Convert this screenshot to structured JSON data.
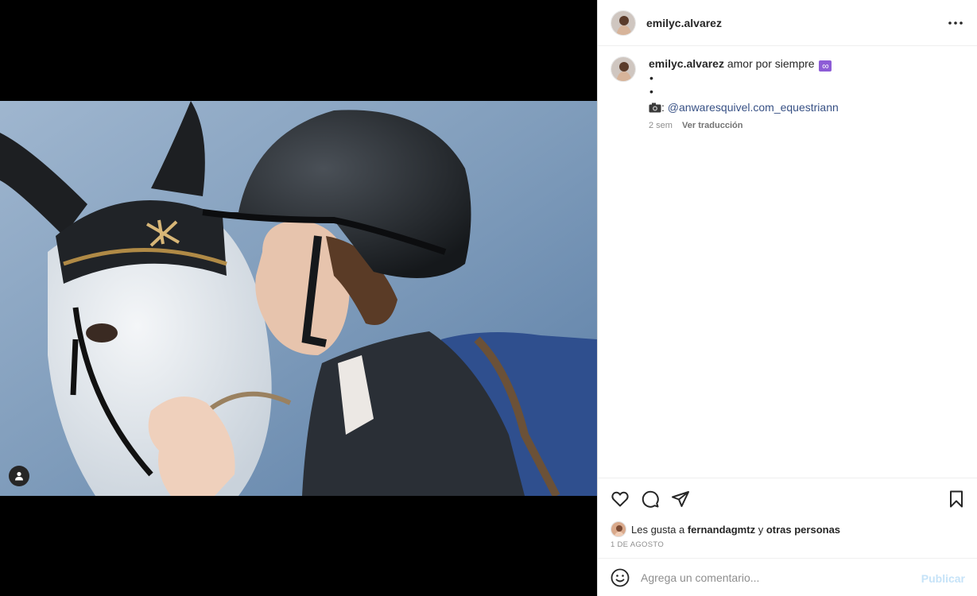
{
  "post": {
    "username": "emilyc.alvarez",
    "caption": {
      "username": "emilyc.alvarez",
      "text": "amor por siempre",
      "emoji": "∞",
      "bullets": [
        "•",
        "•"
      ],
      "credit_prefix": ":",
      "mention": "@anwaresquivel.com_equestriann",
      "time_ago": "2 sem",
      "translate_label": "Ver traducción"
    },
    "likes": {
      "prefix": "Les gusta a",
      "user": "fernandagmtz",
      "connector": "y",
      "others": "otras personas"
    },
    "date": "1 DE AGOSTO"
  },
  "comment": {
    "placeholder": "Agrega un comentario...",
    "publish_label": "Publicar"
  },
  "colors": {
    "link": "#385185",
    "muted": "#8e8e8e",
    "publish_disabled": "#c6e3f8",
    "emoji_bg": "#8d5cd6"
  },
  "icons": {
    "more": "more-options-icon",
    "like": "heart-icon",
    "comment": "comment-icon",
    "share": "share-icon",
    "save": "bookmark-icon",
    "emoji": "smiley-icon",
    "tag": "user-tag-icon",
    "camera": "camera-icon"
  }
}
